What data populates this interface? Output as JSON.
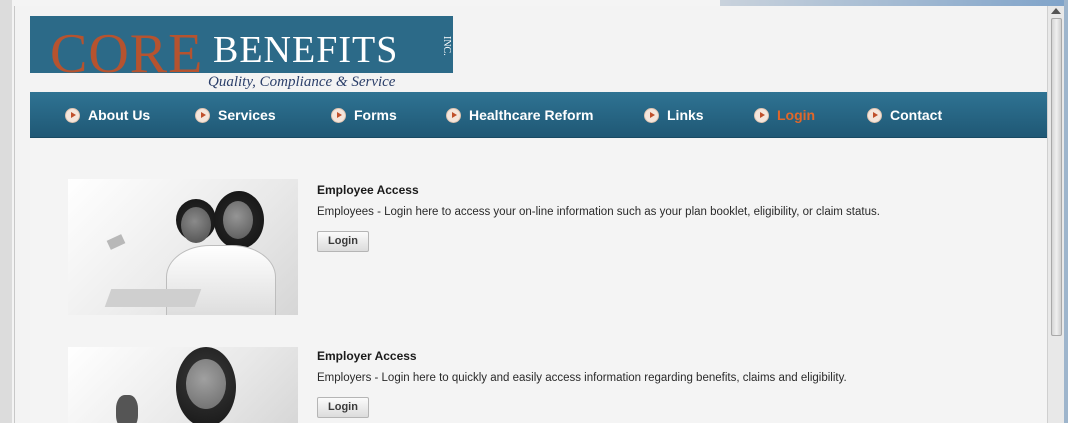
{
  "logo": {
    "core": "CORE",
    "benefits": "BENEFITS",
    "inc": "INC.",
    "tagline": "Quality, Compliance & Service"
  },
  "nav": {
    "items": [
      {
        "label": "About Us"
      },
      {
        "label": "Services"
      },
      {
        "label": "Forms"
      },
      {
        "label": "Healthcare Reform"
      },
      {
        "label": "Links"
      },
      {
        "label": "Login",
        "active": true
      },
      {
        "label": "Contact"
      }
    ],
    "icon": "arrow-circle-icon"
  },
  "employee": {
    "title": "Employee Access",
    "description": "Employees - Login here to access your on-line information such as your plan booklet, eligibility, or claim status.",
    "button": "Login"
  },
  "employer": {
    "title": "Employer Access",
    "description": "Employers - Login here to quickly and easily access information regarding benefits, claims and eligibility.",
    "button": "Login"
  },
  "colors": {
    "brand_blue": "#2c6a88",
    "brand_orange": "#b6532f",
    "nav_active": "#e0672a"
  }
}
